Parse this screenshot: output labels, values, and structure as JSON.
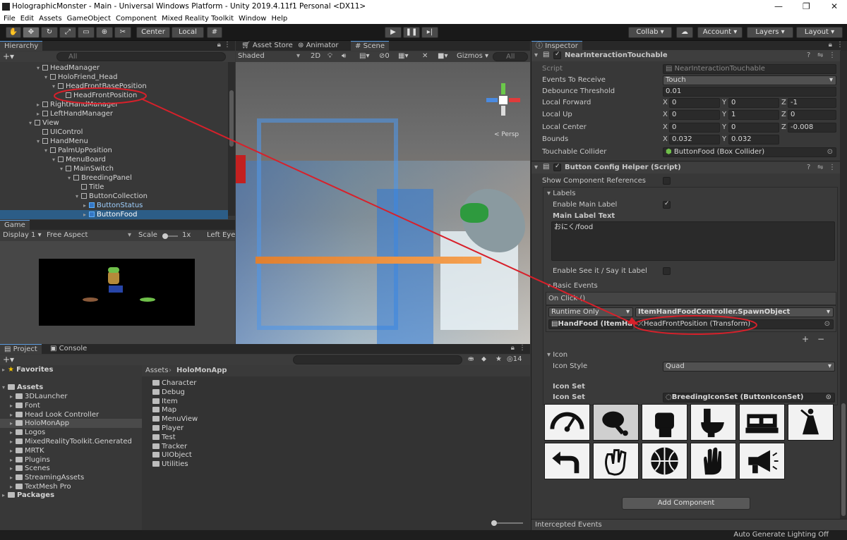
{
  "window": {
    "title": "HolographicMonster - Main - Universal Windows Platform - Unity 2019.4.11f1 Personal <DX11>"
  },
  "menu": [
    "File",
    "Edit",
    "Assets",
    "GameObject",
    "Component",
    "Mixed Reality Toolkit",
    "Window",
    "Help"
  ],
  "toolbar": {
    "center": "Center",
    "local": "Local",
    "collab": "Collab ▾",
    "account": "Account",
    "layers": "Layers",
    "layout": "Layout"
  },
  "hierarchy": {
    "tab": "Hierarchy",
    "search": "All",
    "items": [
      {
        "label": "HeadManager",
        "indent": 0,
        "arrow": "▾"
      },
      {
        "label": "HoloFriend_Head",
        "indent": 1,
        "arrow": "▾"
      },
      {
        "label": "HeadFrontBasePosition",
        "indent": 2,
        "arrow": "▾"
      },
      {
        "label": "HeadFrontPosition",
        "indent": 3,
        "arrow": ""
      },
      {
        "label": "RightHandManager",
        "indent": 0,
        "arrow": "▸"
      },
      {
        "label": "LeftHandManager",
        "indent": 0,
        "arrow": "▸"
      },
      {
        "label": "View",
        "indent": -1,
        "arrow": "▾"
      },
      {
        "label": "UIControl",
        "indent": 0,
        "arrow": ""
      },
      {
        "label": "HandMenu",
        "indent": 0,
        "arrow": "▾"
      },
      {
        "label": "PalmUpPosition",
        "indent": 1,
        "arrow": "▾"
      },
      {
        "label": "MenuBoard",
        "indent": 2,
        "arrow": "▾"
      },
      {
        "label": "MainSwitch",
        "indent": 3,
        "arrow": "▾"
      },
      {
        "label": "BreedingPanel",
        "indent": 4,
        "arrow": "▾"
      },
      {
        "label": "Title",
        "indent": 5,
        "arrow": ""
      },
      {
        "label": "ButtonCollection",
        "indent": 5,
        "arrow": "▾"
      },
      {
        "label": "ButtonStatus",
        "indent": 6,
        "arrow": "▸"
      },
      {
        "label": "ButtonFood",
        "indent": 6,
        "arrow": "▸"
      }
    ]
  },
  "game": {
    "tab": "Game",
    "display": "Display 1",
    "aspect": "Free Aspect",
    "scale_label": "Scale",
    "scale_value": "1x",
    "left_eye": "Left Eye"
  },
  "scene": {
    "tabs": [
      "Asset Store",
      "Animator",
      "Scene"
    ],
    "shading": "Shaded",
    "mode2d": "2D",
    "gizmos": "Gizmos",
    "search": "All",
    "persp": "< Persp",
    "count": "0"
  },
  "project": {
    "tabs": [
      "Project",
      "Console"
    ],
    "favorites": "Favorites",
    "assets": "Assets",
    "packages": "Packages",
    "count": "14",
    "tree": [
      "3DLauncher",
      "Font",
      "Head Look Controller",
      "HoloMonApp",
      "Logos",
      "MixedRealityToolkit.Generated",
      "MRTK",
      "Plugins",
      "Scenes",
      "StreamingAssets",
      "TextMesh Pro"
    ],
    "breadcrumb": [
      "Assets",
      "HoloMonApp"
    ],
    "folders": [
      "Character",
      "Debug",
      "Item",
      "Map",
      "MenuView",
      "Player",
      "Test",
      "Tracker",
      "UIObject",
      "Utilities"
    ]
  },
  "inspector": {
    "tab": "Inspector",
    "component1": "NearInteractionTouchable",
    "script_label": "Script",
    "script_value": "NearInteractionTouchable",
    "events_label": "Events To Receive",
    "events_value": "Touch",
    "debounce_label": "Debounce Threshold",
    "debounce_value": "0.01",
    "forward_label": "Local Forward",
    "forward": [
      "0",
      "0",
      "-1"
    ],
    "up_label": "Local Up",
    "up": [
      "0",
      "1",
      "0"
    ],
    "center_label": "Local Center",
    "center": [
      "0",
      "0",
      "-0.008"
    ],
    "bounds_label": "Bounds",
    "bounds": [
      "0.032",
      "0.032"
    ],
    "collider_label": "Touchable Collider",
    "collider_value": "ButtonFood (Box Collider)",
    "component2": "Button Config Helper (Script)",
    "show_refs": "Show Component References",
    "labels": "Labels",
    "enable_main": "Enable Main Label",
    "main_text_label": "Main Label Text",
    "main_text": "おにく/food",
    "enable_see": "Enable See it / Say it Label",
    "basic_events": "Basic Events",
    "on_click": "On Click ()",
    "runtime": "Runtime Only",
    "function": "ItemHandFoodController.SpawnObject",
    "object": "HandFood (ItemHa",
    "param": "HeadFrontPosition (Transform)",
    "icon": "Icon",
    "icon_style_label": "Icon Style",
    "icon_style": "Quad",
    "icon_set_header": "Icon Set",
    "icon_set_label": "Icon Set",
    "icon_set_value": "BreedingIconSet (ButtonIconSet)",
    "icons": [
      "speedometer-icon",
      "drumstick-icon",
      "fist-icon",
      "toilet-icon",
      "bed-icon",
      "dancer-icon",
      "undo-arrow-icon",
      "wave-hand-icon",
      "basketball-icon",
      "raised-hand-icon",
      "megaphone-icon"
    ],
    "add_component": "Add Component",
    "intercepted": "Intercepted Events",
    "x": "X",
    "y": "Y",
    "z": "Z"
  },
  "status": {
    "right": "Auto Generate Lighting Off"
  }
}
